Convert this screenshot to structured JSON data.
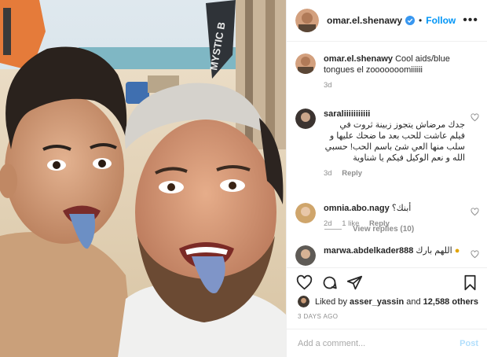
{
  "post": {
    "username": "omar.el.shenawy",
    "follow_label": "Follow",
    "more_icon": "more-options-icon",
    "caption_text": "Cool aids/blue tongues el zooooooomiiiiii",
    "caption_age": "3d",
    "photo_sign_text": "MYSTIC B"
  },
  "comments": [
    {
      "username": "saraliiiiiiiiiii",
      "text": "جدك مرضاش يتجوز زبينة ثروت في فيلم عاشت للحب بعد ما ضحك عليها و سلب منها العي شئ باسم الحب! حسبي الله و نعم الوكيل فيكم يا شناوية",
      "age": "3d",
      "reply_label": "Reply"
    },
    {
      "username": "omnia.abo.nagy",
      "text": "أبنك؟",
      "age": "2d",
      "likes": "1 like",
      "reply_label": "Reply"
    },
    {
      "username": "marwa.abdelkader888",
      "text": "اللهم بارك"
    }
  ],
  "view_replies_label": "View replies (10)",
  "likes": {
    "prefix": "Liked by",
    "user": "asser_yassin",
    "connector": "and",
    "others": "12,588 others"
  },
  "timestamp": "3 DAYS AGO",
  "add_comment": {
    "placeholder": "Add a comment...",
    "post_label": "Post"
  },
  "colors": {
    "accent": "#0095f6",
    "post_disabled": "#b2dffc",
    "muted": "#8e8e8e"
  }
}
